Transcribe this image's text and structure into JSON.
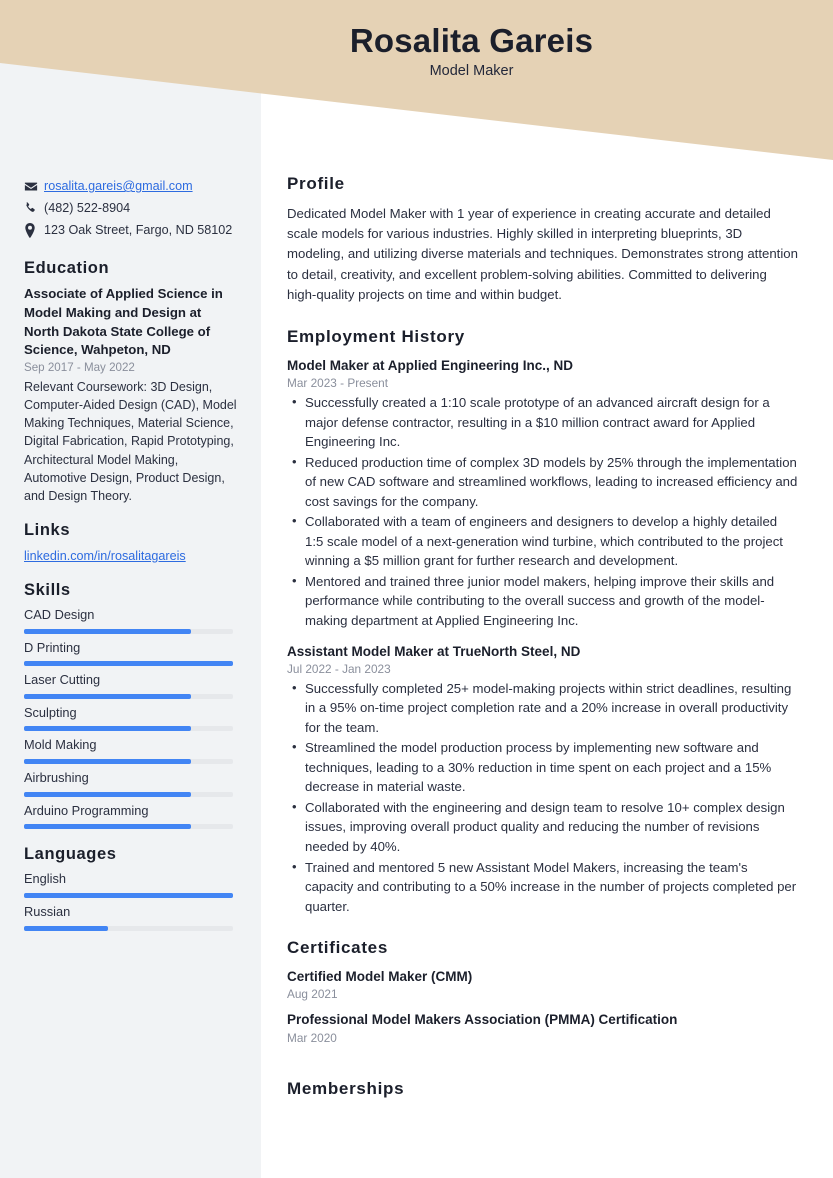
{
  "header": {
    "name": "Rosalita Gareis",
    "job_title": "Model Maker",
    "band_color": "#E5D2B5"
  },
  "colors": {
    "sidebar_bg": "#F1F3F5",
    "accent_bar": "#4285F4",
    "link": "#2D6BE0",
    "text": "#2B3040",
    "muted": "#8A8F9C"
  },
  "sidebar": {
    "contact": [
      {
        "icon": "envelope-icon",
        "text": "rosalita.gareis@gmail.com",
        "is_link": true
      },
      {
        "icon": "phone-icon",
        "text": "(482) 522-8904",
        "is_link": false
      },
      {
        "icon": "map-pin-icon",
        "text": "123 Oak Street, Fargo, ND 58102",
        "is_link": false
      }
    ],
    "education": {
      "heading": "Education",
      "degree": "Associate of Applied Science in Model Making and Design at North Dakota State College of Science, Wahpeton, ND",
      "date": "Sep 2017 - May 2022",
      "description": "Relevant Coursework: 3D Design, Computer-Aided Design (CAD), Model Making Techniques, Material Science, Digital Fabrication, Rapid Prototyping, Architectural Model Making, Automotive Design, Product Design, and Design Theory."
    },
    "links": {
      "heading": "Links",
      "items": [
        {
          "label": "linkedin.com/in/rosalitagareis"
        }
      ]
    },
    "skills": {
      "heading": "Skills",
      "items": [
        {
          "label": "CAD Design",
          "level": 80
        },
        {
          "label": "D Printing",
          "level": 100
        },
        {
          "label": "Laser Cutting",
          "level": 80
        },
        {
          "label": "Sculpting",
          "level": 80
        },
        {
          "label": "Mold Making",
          "level": 80
        },
        {
          "label": "Airbrushing",
          "level": 80
        },
        {
          "label": "Arduino Programming",
          "level": 80
        }
      ]
    },
    "languages": {
      "heading": "Languages",
      "items": [
        {
          "label": "English",
          "level": 100
        },
        {
          "label": "Russian",
          "level": 40
        }
      ]
    }
  },
  "main": {
    "profile": {
      "heading": "Profile",
      "text": "Dedicated Model Maker with 1 year of experience in creating accurate and detailed scale models for various industries. Highly skilled in interpreting blueprints, 3D modeling, and utilizing diverse materials and techniques. Demonstrates strong attention to detail, creativity, and excellent problem-solving abilities. Committed to delivering high-quality projects on time and within budget."
    },
    "employment": {
      "heading": "Employment History",
      "jobs": [
        {
          "title": "Model Maker at Applied Engineering Inc., ND",
          "date": "Mar 2023 - Present",
          "bullets": [
            "Successfully created a 1:10 scale prototype of an advanced aircraft design for a major defense contractor, resulting in a $10 million contract award for Applied Engineering Inc.",
            "Reduced production time of complex 3D models by 25% through the implementation of new CAD software and streamlined workflows, leading to increased efficiency and cost savings for the company.",
            "Collaborated with a team of engineers and designers to develop a highly detailed 1:5 scale model of a next-generation wind turbine, which contributed to the project winning a $5 million grant for further research and development.",
            "Mentored and trained three junior model makers, helping improve their skills and performance while contributing to the overall success and growth of the model-making department at Applied Engineering Inc."
          ]
        },
        {
          "title": "Assistant Model Maker at TrueNorth Steel, ND",
          "date": "Jul 2022 - Jan 2023",
          "bullets": [
            "Successfully completed 25+ model-making projects within strict deadlines, resulting in a 95% on-time project completion rate and a 20% increase in overall productivity for the team.",
            "Streamlined the model production process by implementing new software and techniques, leading to a 30% reduction in time spent on each project and a 15% decrease in material waste.",
            "Collaborated with the engineering and design team to resolve 10+ complex design issues, improving overall product quality and reducing the number of revisions needed by 40%.",
            "Trained and mentored 5 new Assistant Model Makers, increasing the team's capacity and contributing to a 50% increase in the number of projects completed per quarter."
          ]
        }
      ]
    },
    "certificates": {
      "heading": "Certificates",
      "items": [
        {
          "name": "Certified Model Maker (CMM)",
          "date": "Aug 2021"
        },
        {
          "name": "Professional Model Makers Association (PMMA) Certification",
          "date": "Mar 2020"
        }
      ]
    },
    "memberships": {
      "heading": "Memberships"
    }
  }
}
